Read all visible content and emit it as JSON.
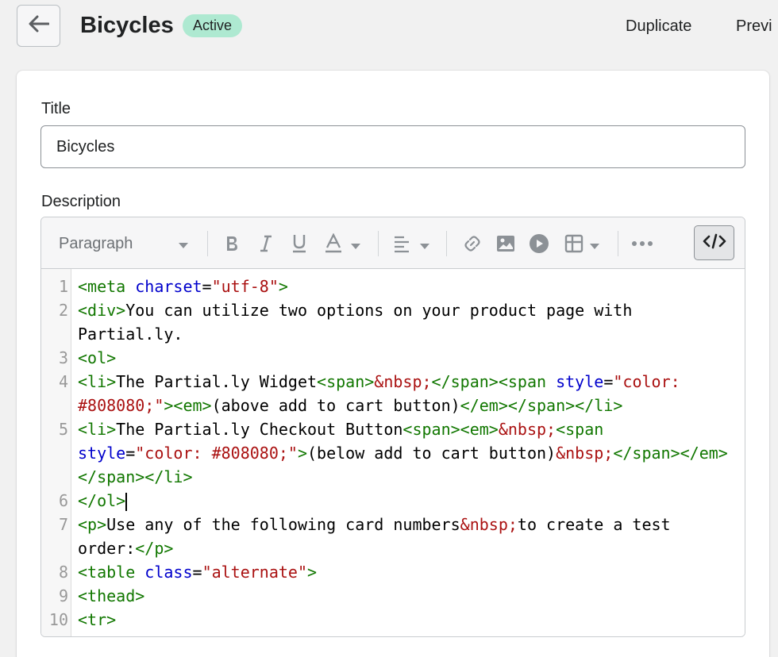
{
  "header": {
    "back_label": "",
    "title": "Bicycles",
    "status": "Active",
    "actions": [
      "Duplicate",
      "Previ"
    ]
  },
  "form": {
    "title_label": "Title",
    "title_value": "Bicycles",
    "description_label": "Description"
  },
  "toolbar": {
    "paragraph": "Paragraph",
    "icons": [
      "bold-icon",
      "italic-icon",
      "underline-icon",
      "text-color-icon",
      "align-icon",
      "link-icon",
      "image-icon",
      "video-icon",
      "table-icon",
      "more-icon",
      "code-view-icon"
    ]
  },
  "code": {
    "lines": [
      {
        "n": "1",
        "tokens": [
          [
            "tag",
            "<meta "
          ],
          [
            "attr",
            "charset"
          ],
          [
            "txt",
            "="
          ],
          [
            "str",
            "\"utf-8\""
          ],
          [
            "tag",
            ">"
          ]
        ]
      },
      {
        "n": "2",
        "tokens": [
          [
            "tag",
            "<div>"
          ],
          [
            "txt",
            "You can utilize two options on your product page with Partial.ly."
          ]
        ]
      },
      {
        "n": "3",
        "tokens": [
          [
            "tag",
            "<ol>"
          ]
        ]
      },
      {
        "n": "4",
        "tokens": [
          [
            "tag",
            "<li>"
          ],
          [
            "txt",
            "The Partial.ly Widget"
          ],
          [
            "tag",
            "<span>"
          ],
          [
            "ent",
            "&nbsp;"
          ],
          [
            "tag",
            "</span><span "
          ],
          [
            "attr",
            "style"
          ],
          [
            "txt",
            "="
          ],
          [
            "str",
            "\"color: #808080;\""
          ],
          [
            "tag",
            "><em>"
          ],
          [
            "txt",
            "(above add to cart button)"
          ],
          [
            "tag",
            "</em></span></li>"
          ]
        ]
      },
      {
        "n": "5",
        "tokens": [
          [
            "tag",
            "<li>"
          ],
          [
            "txt",
            "The Partial.ly Checkout Button"
          ],
          [
            "tag",
            "<span><em>"
          ],
          [
            "ent",
            "&nbsp;"
          ],
          [
            "tag",
            "<span "
          ],
          [
            "attr",
            "style"
          ],
          [
            "txt",
            "="
          ],
          [
            "str",
            "\"color: #808080;\""
          ],
          [
            "tag",
            ">"
          ],
          [
            "txt",
            "(below add to cart button)"
          ],
          [
            "ent",
            "&nbsp;"
          ],
          [
            "tag",
            "</span></em></span></li>"
          ]
        ]
      },
      {
        "n": "6",
        "tokens": [
          [
            "tag",
            "</ol>"
          ]
        ],
        "cursor": true
      },
      {
        "n": "7",
        "tokens": [
          [
            "tag",
            "<p>"
          ],
          [
            "txt",
            "Use any of the following card numbers"
          ],
          [
            "ent",
            "&nbsp;"
          ],
          [
            "txt",
            "to create a test order:"
          ],
          [
            "tag",
            "</p>"
          ]
        ]
      },
      {
        "n": "8",
        "tokens": [
          [
            "tag",
            "<table "
          ],
          [
            "attr",
            "class"
          ],
          [
            "txt",
            "="
          ],
          [
            "str",
            "\"alternate\""
          ],
          [
            "tag",
            ">"
          ]
        ]
      },
      {
        "n": "9",
        "tokens": [
          [
            "tag",
            "<thead>"
          ]
        ]
      },
      {
        "n": "10",
        "tokens": [
          [
            "tag",
            "<tr>"
          ]
        ]
      }
    ]
  },
  "colors": {
    "tag": "#117700",
    "attr": "#0000cc",
    "str": "#aa1111",
    "ent": "#aa1111",
    "txt": "#000000",
    "badge_bg": "#aee9d1"
  }
}
